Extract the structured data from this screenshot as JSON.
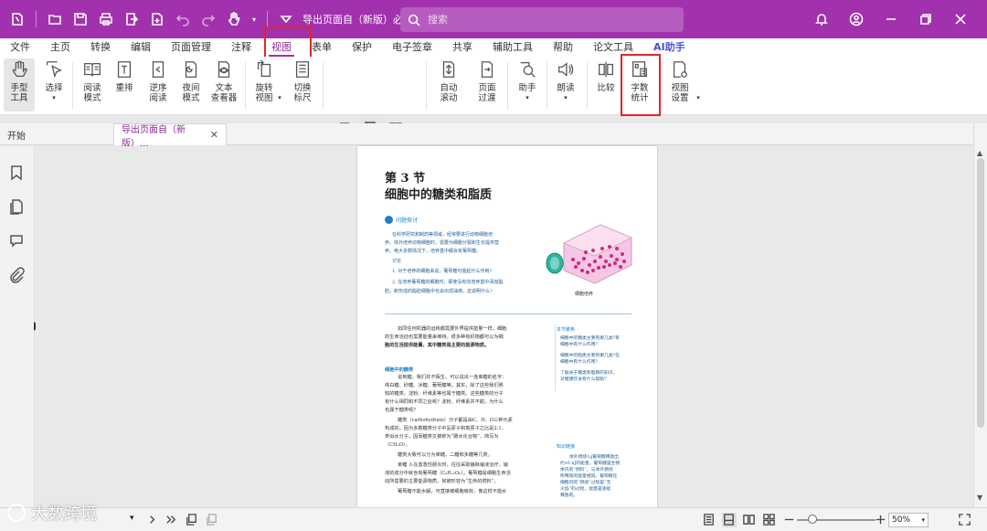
{
  "titlebar": {
    "doc_title": "导出页面自（新版）必修1分...",
    "search_placeholder": "搜索"
  },
  "menu": {
    "tabs": [
      "文件",
      "主页",
      "转换",
      "编辑",
      "页面管理",
      "注释",
      "视图",
      "表单",
      "保护",
      "电子签章",
      "共享",
      "辅助工具",
      "帮助",
      "论文工具",
      "AI助手"
    ],
    "active": "视图"
  },
  "ribbon": {
    "hand_tool": "手型\n工具",
    "select": "选择",
    "read_mode": "阅读\n模式",
    "reflow": "重排",
    "reverse_read": "逆序\n阅读",
    "night_mode": "夜间\n模式",
    "text_viewer": "文本\n查看器",
    "rotate_view": "旋转\n视图",
    "toggle_ruler": "切换\n标尺",
    "auto_scroll": "自动\n滚动",
    "page_transition": "页面\n过渡",
    "assistant": "助手",
    "read_aloud": "朗读",
    "compare": "比较",
    "word_count": "字数\n统计",
    "view_settings": "视图\n设置"
  },
  "tabs": {
    "start": "开始",
    "doc": "导出页面自（新版）..."
  },
  "page": {
    "section": "第 3 节",
    "subtitle": "细胞中的糖类和脂质",
    "qa_label": "问题探讨",
    "qa_lines": [
      "在科学研究和制药等领域，经常要进行动物细胞培",
      "养。体外培养动物细胞时，需要为细胞分裂和生长提供营",
      "养。绝大多数情况下，培养基中都会有葡萄糖。",
      "讨论",
      "1. 对于培养的细胞来说，葡萄糖可能起什么作用?",
      "2. 在培养葡萄糖的细胞时，即使没有向培养基中添加脂",
      "肪，新形成的脂肪细胞中也会出现油滴，这说明什么?"
    ],
    "fig_caption": "细胞培养",
    "body_lines": [
      "如同任何机器的运转都需要外界提供能量一样，细胞",
      "的生命活动也需要能量来维持。很多种有机物都可以为细",
      "胞的生活提供能量，其中糖类是主要的能源物质。"
    ],
    "sugar_head": "细胞中的糖类",
    "sugar_lines": [
      "说到糖，我们并不陌生，可以说出一连串糖的名字：",
      "绵白糖、砂糖、冰糖、葡萄糖等。其实，除了这些我们熟",
      "知的糖类，淀粉、纤维素等也属于糖类。这些糖类的分子",
      "有什么相同和不同之处呢？淀粉、纤维素并不甜，为什么",
      "也属于糖类呢?",
      "糖类（carbohydrate）分子都是由C、H、O三种元素",
      "构成的。因为多数糖类分子中氢原子和氧原子之比是2:1，",
      "类似水分子，因而糖类又被称为“碳水化合物”，简写为",
      "（CH₂O）。",
      "糖类大致可以分为单糖、二糖和多糖等几类。",
      "单糖  人在患急性肠炎时，往往采取静脉输液治疗，输",
      "液的成分中就含有葡萄糖（C₆H₁₂O₆）。葡萄糖是细胞生命活",
      "动所需要的主要能源物质，常被形容为“生命的燃料”。",
      "葡萄糖不能水解，可直接被细胞吸收，像这样不能水"
    ],
    "side_head": "本节聚焦",
    "side_lines": [
      "细胞中的糖类主要有哪几类?有",
      "细胞中有什么作用?",
      "细胞中的脂质主要有哪几类?在",
      "细胞中有什么作用?",
      "了解关于糖类和脂质的知识，",
      "对健康饮食有什么帮助?"
    ],
    "side_head2": "知识链接",
    "side2_lines": [
      "体外燃烧1g葡萄糖释放出",
      "约16 kJ的能量，葡萄糖是生物",
      "体内的“燃料”，与体外燃烧",
      "所释放的能量相同。葡萄糖在",
      "细胞内的“燃烧”过程是“无",
      "火焰”的过程，能量是逐级",
      "释放的。"
    ]
  },
  "status": {
    "zoom": "50%",
    "zoom_level": 0.2
  },
  "watermark": "大数跨境",
  "colors": {
    "brand": "#a231ae",
    "highlight": "#e0262b",
    "accent_blue": "#1e7fc8"
  }
}
